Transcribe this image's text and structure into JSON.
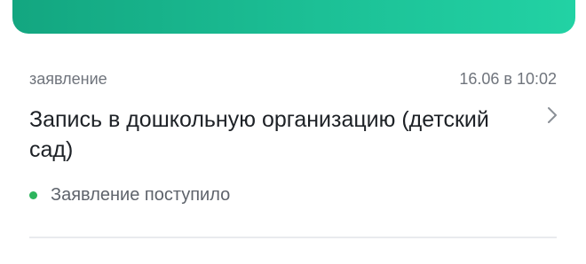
{
  "banner": {
    "icon": "pen-icon",
    "color_start": "#13a680",
    "color_end": "#22d2a4"
  },
  "card": {
    "type_label": "заявление",
    "date": "16.06 в 10:02",
    "title": "Запись в дошкольную организацию (детский сад)",
    "status": {
      "text": "Заявление поступило",
      "color": "#2cb45c"
    },
    "chevron_icon": "chevron-right-icon"
  }
}
